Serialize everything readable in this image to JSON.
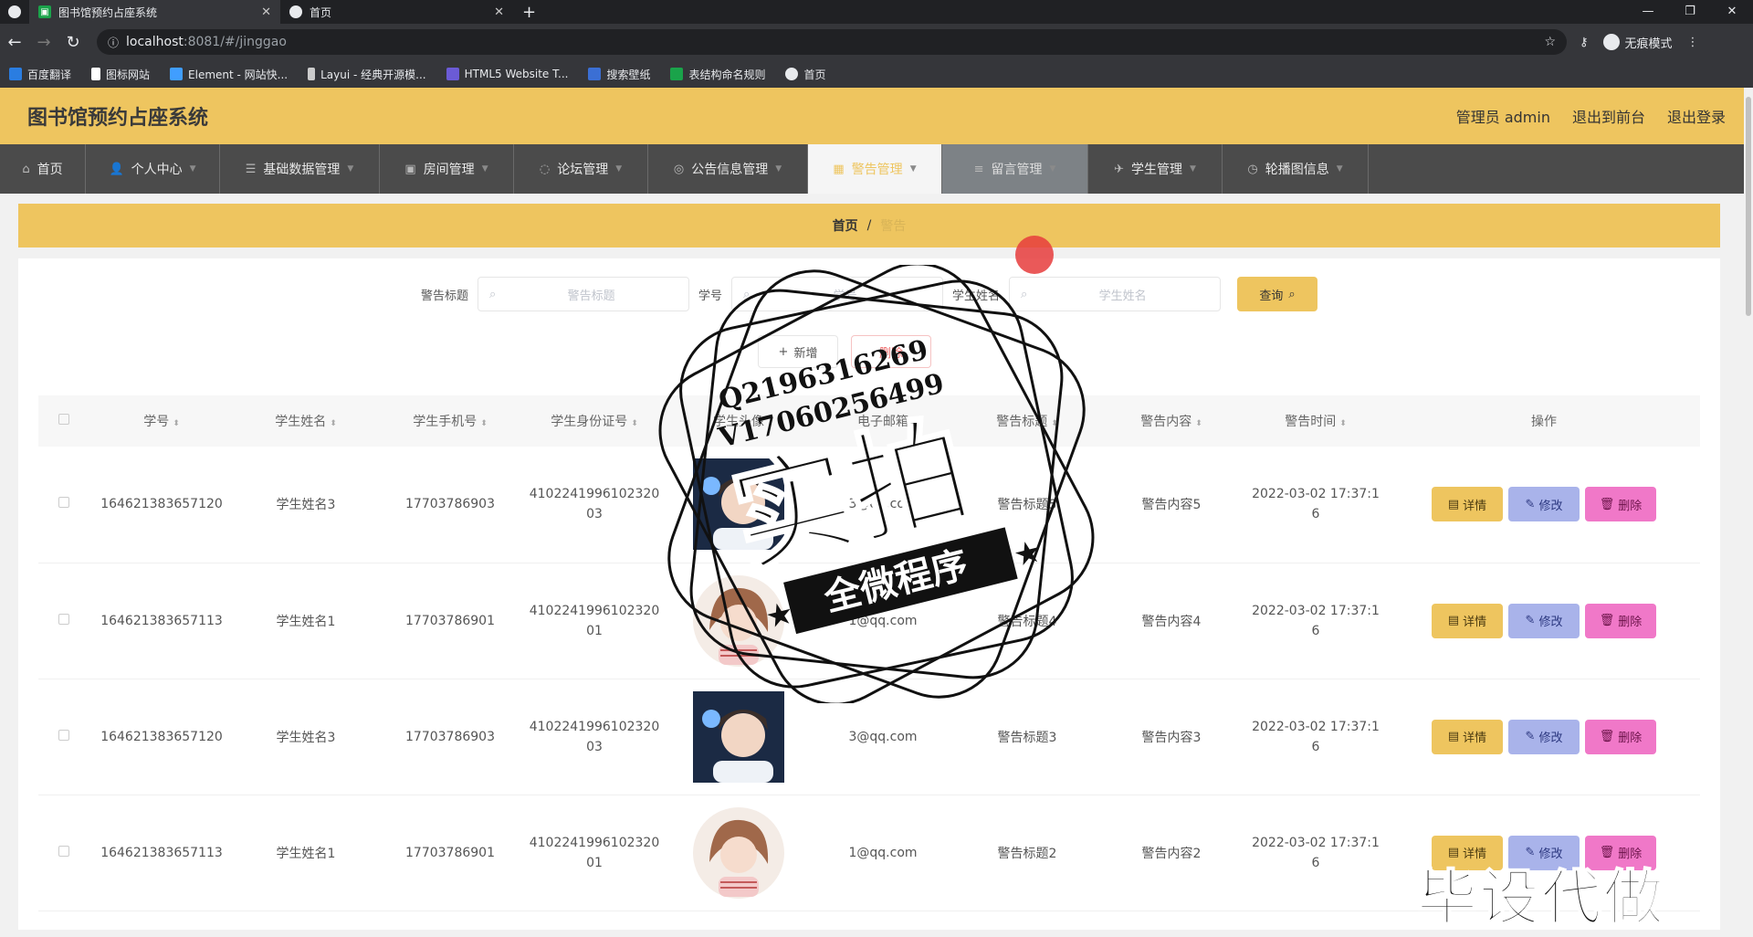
{
  "browser": {
    "tabs": [
      {
        "title": "图书馆预约占座系统",
        "active": true
      },
      {
        "title": "首页",
        "active": false
      }
    ],
    "url_host": "localhost",
    "url_rest": ":8081/#/jinggao",
    "incognito_label": "无痕模式",
    "bookmarks": [
      "百度翻译",
      "图标网站",
      "Element - 网站快...",
      "Layui - 经典开源模...",
      "HTML5 Website T...",
      "搜索壁纸",
      "表结构命名规则",
      "首页"
    ]
  },
  "header": {
    "title": "图书馆预约占座系统",
    "user": "管理员 admin",
    "front": "退出到前台",
    "logout": "退出登录"
  },
  "menu": [
    {
      "label": "首页",
      "icon": "home-icon",
      "glyph": "⌂"
    },
    {
      "label": "个人中心",
      "icon": "user-icon",
      "glyph": "👤"
    },
    {
      "label": "基础数据管理",
      "icon": "list-icon",
      "glyph": "☰"
    },
    {
      "label": "房间管理",
      "icon": "room-icon",
      "glyph": "▣"
    },
    {
      "label": "论坛管理",
      "icon": "forum-icon",
      "glyph": "◌"
    },
    {
      "label": "公告信息管理",
      "icon": "notice-icon",
      "glyph": "◎"
    },
    {
      "label": "警告管理",
      "icon": "grid-icon",
      "glyph": "▦"
    },
    {
      "label": "留言管理",
      "icon": "message-icon",
      "glyph": "≡"
    },
    {
      "label": "学生管理",
      "icon": "student-icon",
      "glyph": "✈"
    },
    {
      "label": "轮播图信息",
      "icon": "carousel-icon",
      "glyph": "◷"
    }
  ],
  "breadcrumb": {
    "home": "首页",
    "sep": "/",
    "current": "警告"
  },
  "search": {
    "title_label": "警告标题",
    "title_placeholder": "警告标题",
    "no_label": "学号",
    "no_placeholder": "学号",
    "name_label": "学生姓名",
    "name_placeholder": "学生姓名",
    "query_button": "查询"
  },
  "actions": {
    "add": "新增",
    "delete": "删除"
  },
  "table": {
    "columns": [
      "学号",
      "学生姓名",
      "学生手机号",
      "学生身份证号",
      "学生头像",
      "电子邮箱",
      "警告标题",
      "警告内容",
      "警告时间",
      "操作"
    ],
    "rows": [
      {
        "no": "164621383657120",
        "name": "学生姓名3",
        "phone": "17703786903",
        "id1": "4102241996102320",
        "id2": "03",
        "email": "3@qq.com",
        "title": "警告标题5",
        "content": "警告内容5",
        "time1": "2022-03-02 17:37:1",
        "time2": "6",
        "avatar": "boy"
      },
      {
        "no": "164621383657113",
        "name": "学生姓名1",
        "phone": "17703786901",
        "id1": "4102241996102320",
        "id2": "01",
        "email": "1@qq.com",
        "title": "警告标题4",
        "content": "警告内容4",
        "time1": "2022-03-02 17:37:1",
        "time2": "6",
        "avatar": "girl"
      },
      {
        "no": "164621383657120",
        "name": "学生姓名3",
        "phone": "17703786903",
        "id1": "4102241996102320",
        "id2": "03",
        "email": "3@qq.com",
        "title": "警告标题3",
        "content": "警告内容3",
        "time1": "2022-03-02 17:37:1",
        "time2": "6",
        "avatar": "boy"
      },
      {
        "no": "164621383657113",
        "name": "学生姓名1",
        "phone": "17703786901",
        "id1": "4102241996102320",
        "id2": "01",
        "email": "1@qq.com",
        "title": "警告标题2",
        "content": "警告内容2",
        "time1": "2022-03-02 17:37:1",
        "time2": "6",
        "avatar": "girl"
      }
    ],
    "op_detail": "详情",
    "op_edit": "修改",
    "op_delete": "删除"
  },
  "overlay": {
    "qq": "Q2196316269",
    "wechat": "V17060256499",
    "big": "实拍",
    "banner": "全微程序",
    "corner": "毕设代做"
  },
  "colors": {
    "accent": "#eec55f",
    "menu_bg": "#4b4b4b",
    "edit": "#a9b3ea",
    "delete": "#f078c8"
  }
}
